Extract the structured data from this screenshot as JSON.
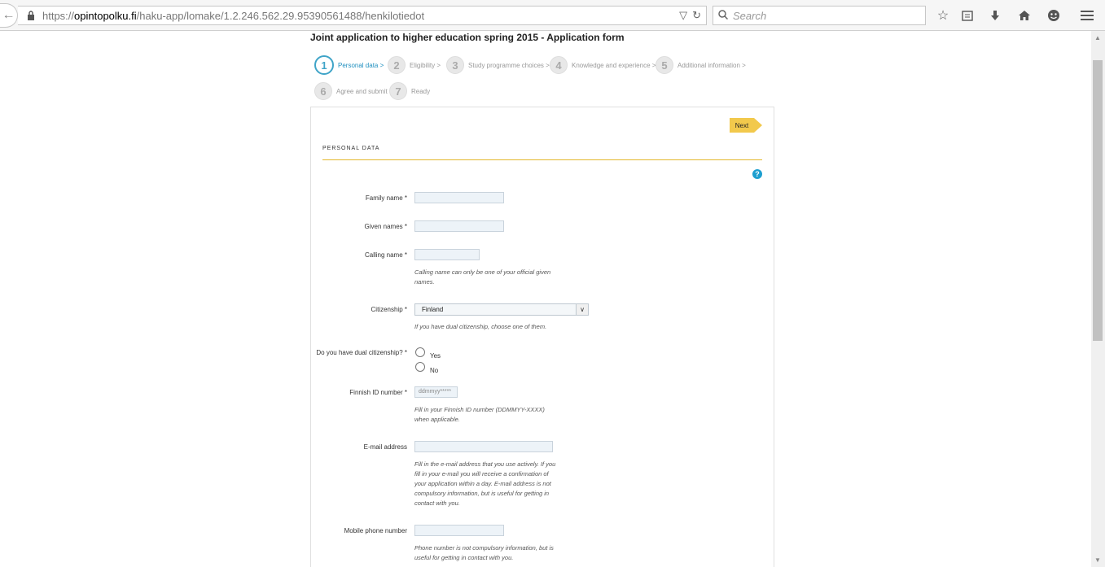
{
  "browser": {
    "url_prefix": "https://",
    "url_host": "opintopolku.fi",
    "url_path": "/haku-app/lomake/1.2.246.562.29.95390561488/henkilotiedot",
    "search_placeholder": "Search"
  },
  "form": {
    "title": "Joint application to higher education spring 2015 - Application form",
    "steps": [
      {
        "num": "1",
        "label": "Personal data >"
      },
      {
        "num": "2",
        "label": "Eligibility >"
      },
      {
        "num": "3",
        "label": "Study programme choices >"
      },
      {
        "num": "4",
        "label": "Knowledge and experience >"
      },
      {
        "num": "5",
        "label": "Additional information >"
      },
      {
        "num": "6",
        "label": "Agree and submit"
      },
      {
        "num": "7",
        "label": "Ready"
      }
    ],
    "next_label": "Next",
    "section_title": "PERSONAL DATA",
    "help": "?",
    "fields": {
      "family_name": {
        "label": "Family name *",
        "value": ""
      },
      "given_names": {
        "label": "Given names *",
        "value": ""
      },
      "calling_name": {
        "label": "Calling name *",
        "value": "",
        "hint_1": "Calling name can only be one of your official given",
        "hint_2": "names."
      },
      "citizenship": {
        "label": "Citizenship *",
        "value": "Finland",
        "hint": "If you have dual citizenship, choose one of them."
      },
      "dual_citizenship": {
        "label": "Do you have dual citizenship? *",
        "yes": "Yes",
        "no": "No"
      },
      "finnish_id": {
        "label": "Finnish ID number *",
        "placeholder": "ddmmyy*****",
        "hint_1": "Fill in your Finnish ID number (DDMMYY-XXXX)",
        "hint_2": "when applicable."
      },
      "email": {
        "label": "E-mail address",
        "value": "",
        "hint_1": "Fill in the e-mail address that you use actively. If you",
        "hint_2": "fill in your e-mail you will receive a confirmation of",
        "hint_3": "your application within a day. E-mail address is not",
        "hint_4": "compulsory information, but is useful for getting in",
        "hint_5": "contact with you."
      },
      "mobile": {
        "label": "Mobile phone number",
        "value": "",
        "hint_1": "Phone number is not compulsory information, but is",
        "hint_2": "useful for getting in contact with you."
      }
    }
  },
  "colors": {
    "accent": "#3fa4c8",
    "next_button": "#f2c94c",
    "section_line": "#e3b72c"
  }
}
